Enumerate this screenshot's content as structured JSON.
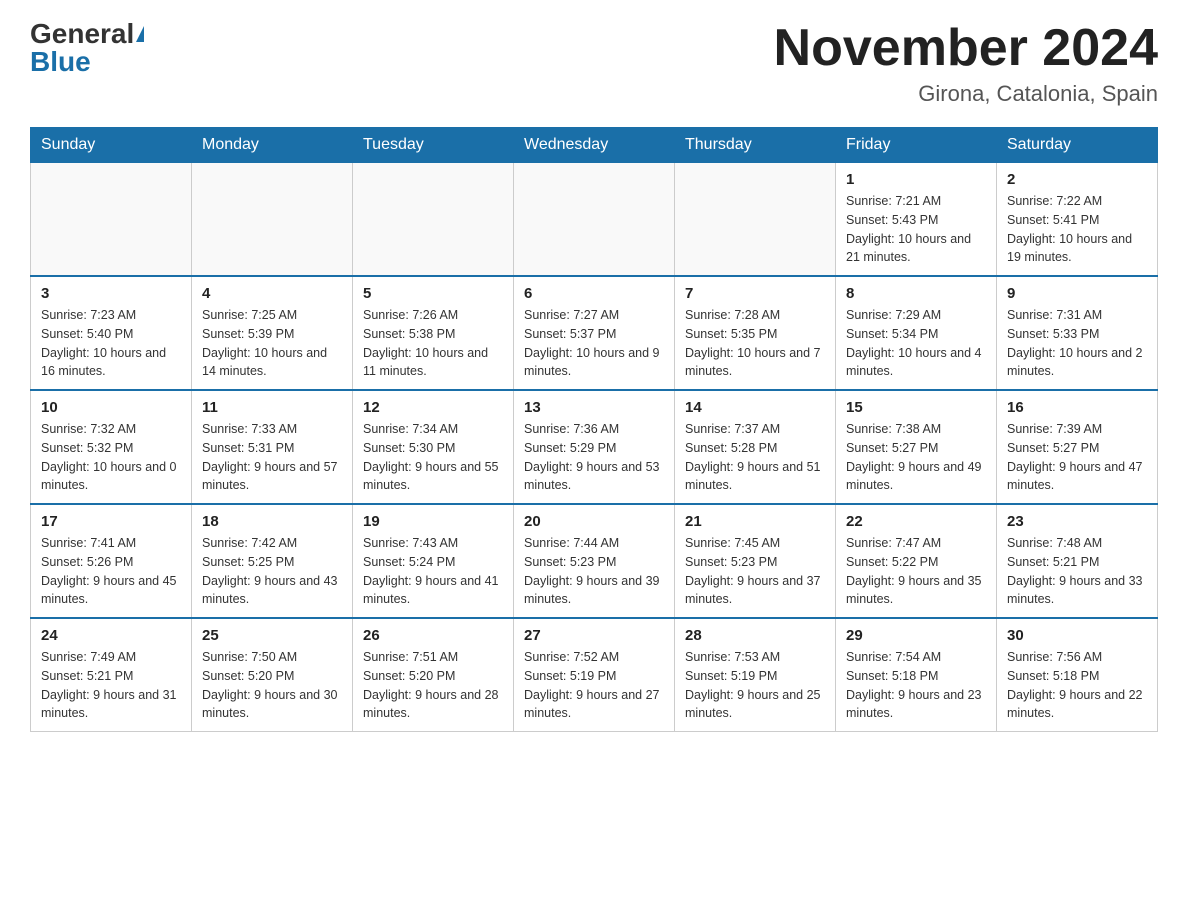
{
  "header": {
    "logo_general": "General",
    "logo_blue": "Blue",
    "month_title": "November 2024",
    "location": "Girona, Catalonia, Spain"
  },
  "days_of_week": [
    "Sunday",
    "Monday",
    "Tuesday",
    "Wednesday",
    "Thursday",
    "Friday",
    "Saturday"
  ],
  "weeks": [
    [
      {
        "day": "",
        "info": ""
      },
      {
        "day": "",
        "info": ""
      },
      {
        "day": "",
        "info": ""
      },
      {
        "day": "",
        "info": ""
      },
      {
        "day": "",
        "info": ""
      },
      {
        "day": "1",
        "info": "Sunrise: 7:21 AM\nSunset: 5:43 PM\nDaylight: 10 hours and 21 minutes."
      },
      {
        "day": "2",
        "info": "Sunrise: 7:22 AM\nSunset: 5:41 PM\nDaylight: 10 hours and 19 minutes."
      }
    ],
    [
      {
        "day": "3",
        "info": "Sunrise: 7:23 AM\nSunset: 5:40 PM\nDaylight: 10 hours and 16 minutes."
      },
      {
        "day": "4",
        "info": "Sunrise: 7:25 AM\nSunset: 5:39 PM\nDaylight: 10 hours and 14 minutes."
      },
      {
        "day": "5",
        "info": "Sunrise: 7:26 AM\nSunset: 5:38 PM\nDaylight: 10 hours and 11 minutes."
      },
      {
        "day": "6",
        "info": "Sunrise: 7:27 AM\nSunset: 5:37 PM\nDaylight: 10 hours and 9 minutes."
      },
      {
        "day": "7",
        "info": "Sunrise: 7:28 AM\nSunset: 5:35 PM\nDaylight: 10 hours and 7 minutes."
      },
      {
        "day": "8",
        "info": "Sunrise: 7:29 AM\nSunset: 5:34 PM\nDaylight: 10 hours and 4 minutes."
      },
      {
        "day": "9",
        "info": "Sunrise: 7:31 AM\nSunset: 5:33 PM\nDaylight: 10 hours and 2 minutes."
      }
    ],
    [
      {
        "day": "10",
        "info": "Sunrise: 7:32 AM\nSunset: 5:32 PM\nDaylight: 10 hours and 0 minutes."
      },
      {
        "day": "11",
        "info": "Sunrise: 7:33 AM\nSunset: 5:31 PM\nDaylight: 9 hours and 57 minutes."
      },
      {
        "day": "12",
        "info": "Sunrise: 7:34 AM\nSunset: 5:30 PM\nDaylight: 9 hours and 55 minutes."
      },
      {
        "day": "13",
        "info": "Sunrise: 7:36 AM\nSunset: 5:29 PM\nDaylight: 9 hours and 53 minutes."
      },
      {
        "day": "14",
        "info": "Sunrise: 7:37 AM\nSunset: 5:28 PM\nDaylight: 9 hours and 51 minutes."
      },
      {
        "day": "15",
        "info": "Sunrise: 7:38 AM\nSunset: 5:27 PM\nDaylight: 9 hours and 49 minutes."
      },
      {
        "day": "16",
        "info": "Sunrise: 7:39 AM\nSunset: 5:27 PM\nDaylight: 9 hours and 47 minutes."
      }
    ],
    [
      {
        "day": "17",
        "info": "Sunrise: 7:41 AM\nSunset: 5:26 PM\nDaylight: 9 hours and 45 minutes."
      },
      {
        "day": "18",
        "info": "Sunrise: 7:42 AM\nSunset: 5:25 PM\nDaylight: 9 hours and 43 minutes."
      },
      {
        "day": "19",
        "info": "Sunrise: 7:43 AM\nSunset: 5:24 PM\nDaylight: 9 hours and 41 minutes."
      },
      {
        "day": "20",
        "info": "Sunrise: 7:44 AM\nSunset: 5:23 PM\nDaylight: 9 hours and 39 minutes."
      },
      {
        "day": "21",
        "info": "Sunrise: 7:45 AM\nSunset: 5:23 PM\nDaylight: 9 hours and 37 minutes."
      },
      {
        "day": "22",
        "info": "Sunrise: 7:47 AM\nSunset: 5:22 PM\nDaylight: 9 hours and 35 minutes."
      },
      {
        "day": "23",
        "info": "Sunrise: 7:48 AM\nSunset: 5:21 PM\nDaylight: 9 hours and 33 minutes."
      }
    ],
    [
      {
        "day": "24",
        "info": "Sunrise: 7:49 AM\nSunset: 5:21 PM\nDaylight: 9 hours and 31 minutes."
      },
      {
        "day": "25",
        "info": "Sunrise: 7:50 AM\nSunset: 5:20 PM\nDaylight: 9 hours and 30 minutes."
      },
      {
        "day": "26",
        "info": "Sunrise: 7:51 AM\nSunset: 5:20 PM\nDaylight: 9 hours and 28 minutes."
      },
      {
        "day": "27",
        "info": "Sunrise: 7:52 AM\nSunset: 5:19 PM\nDaylight: 9 hours and 27 minutes."
      },
      {
        "day": "28",
        "info": "Sunrise: 7:53 AM\nSunset: 5:19 PM\nDaylight: 9 hours and 25 minutes."
      },
      {
        "day": "29",
        "info": "Sunrise: 7:54 AM\nSunset: 5:18 PM\nDaylight: 9 hours and 23 minutes."
      },
      {
        "day": "30",
        "info": "Sunrise: 7:56 AM\nSunset: 5:18 PM\nDaylight: 9 hours and 22 minutes."
      }
    ]
  ]
}
